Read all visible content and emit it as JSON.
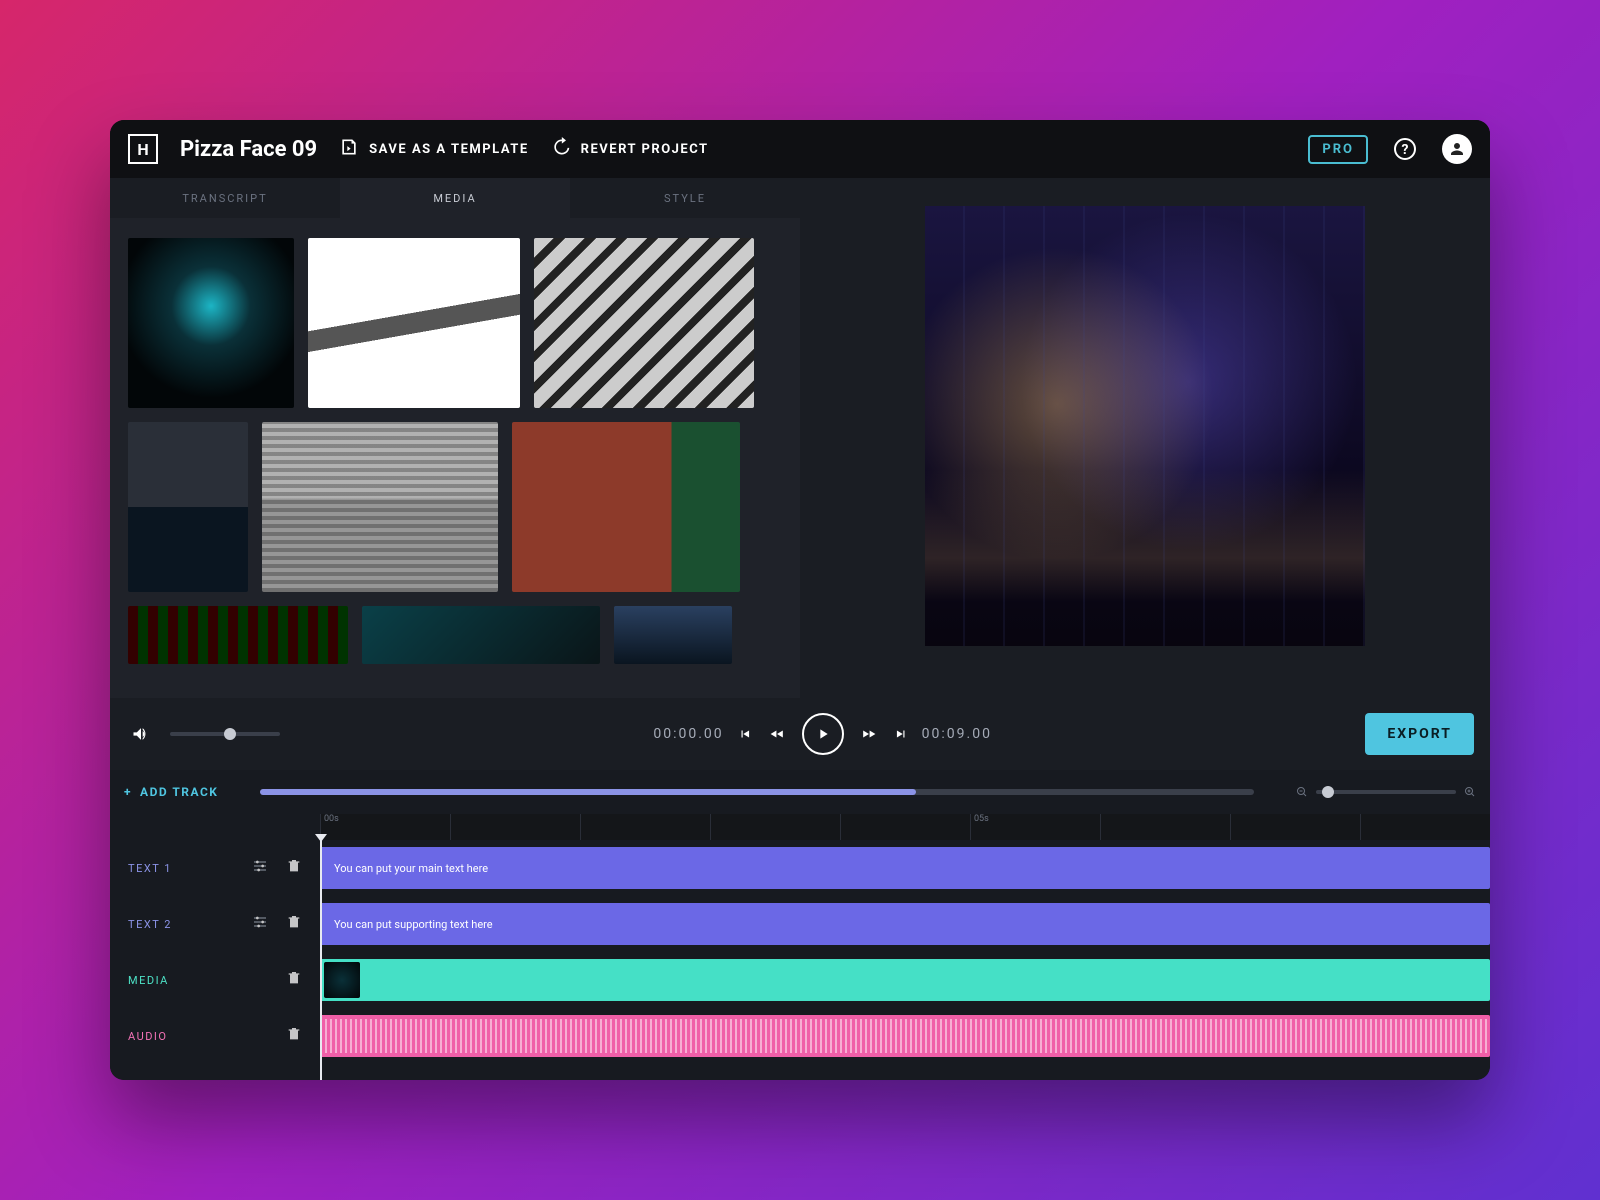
{
  "project_title": "Pizza Face 09",
  "topbar": {
    "save_template": "SAVE AS A TEMPLATE",
    "revert": "REVERT PROJECT",
    "pro": "PRO"
  },
  "tabs": {
    "transcript": "TRANSCRIPT",
    "media": "MEDIA",
    "style": "STYLE"
  },
  "playback": {
    "current": "00:00.00",
    "duration": "00:09.00",
    "export": "EXPORT"
  },
  "timeline": {
    "add_track": "ADD TRACK",
    "ruler": {
      "start": "00s",
      "label_05": "05s"
    },
    "tracks": {
      "text1": {
        "label": "TEXT 1",
        "content": "You can put your main text here"
      },
      "text2": {
        "label": "TEXT 2",
        "content": "You can put supporting text here"
      },
      "media": {
        "label": "MEDIA"
      },
      "audio": {
        "label": "AUDIO"
      }
    }
  }
}
